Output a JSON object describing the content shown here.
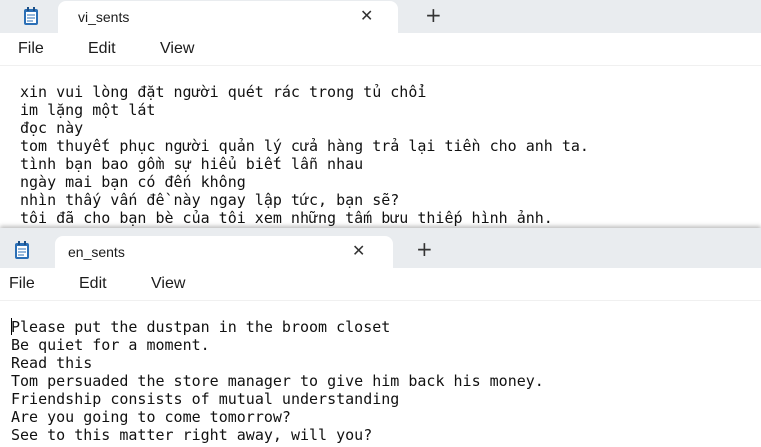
{
  "window_top": {
    "tab_title": "vi_sents",
    "close_glyph": "✕",
    "add_glyph": "+",
    "menu": [
      "File",
      "Edit",
      "View"
    ],
    "lines": [
      "xin vui lòng đặt người quét rác trong tủ chổi",
      "im lặng một lát",
      "đọc này",
      "tom thuyết phục người quản lý cửa hàng trả lại tiền cho anh ta.",
      "tình bạn bao gồm sự hiểu biết lẫn nhau",
      "ngày mai bạn có đến không",
      "nhìn thấy vấn đề này ngay lập tức, bạn sẽ?",
      "tôi đã cho bạn bè của tôi xem những tấm bưu thiếp hình ảnh."
    ]
  },
  "window_bottom": {
    "tab_title": "en_sents",
    "close_glyph": "✕",
    "add_glyph": "+",
    "menu": [
      "File",
      "Edit",
      "View"
    ],
    "lines": [
      "Please put the dustpan in the broom closet",
      "Be quiet for a moment.",
      "Read this",
      "Tom persuaded the store manager to give him back his money.",
      "Friendship consists of mutual understanding",
      "Are you going to come tomorrow?",
      "See to this matter right away, will you?"
    ]
  },
  "icons": {
    "app": "notepad-icon",
    "close": "close-icon",
    "add": "add-tab-icon"
  },
  "colors": {
    "tabbar_bg": "#e9ecef",
    "notepad_icon": "#2b6fb6",
    "text": "#111111"
  }
}
